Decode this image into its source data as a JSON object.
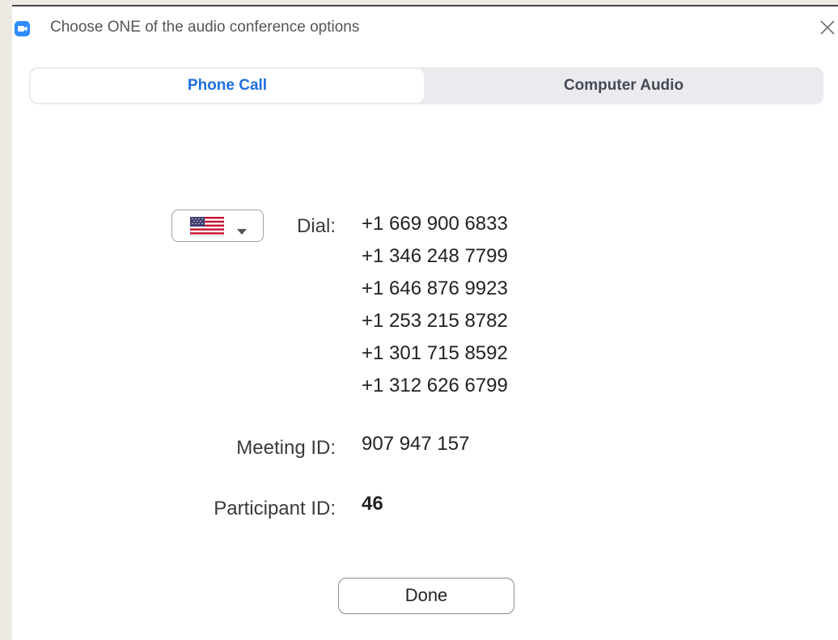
{
  "window": {
    "title": "Choose ONE of the audio conference options",
    "close_icon": "close-icon",
    "app_icon": "zoom-camera-icon",
    "accent_color": "#2d8cff"
  },
  "tabs": [
    {
      "label": "Phone Call",
      "selected": true
    },
    {
      "label": "Computer Audio",
      "selected": false
    }
  ],
  "phone": {
    "country": {
      "icon": "us-flag-icon",
      "dropdown_icon": "caret-down-icon"
    },
    "dial_label": "Dial:",
    "numbers": [
      "+1 669 900 6833",
      "+1 346 248 7799",
      "+1 646 876 9923",
      "+1 253 215 8782",
      "+1 301 715 8592",
      "+1 312 626 6799"
    ],
    "meeting_id_label": "Meeting ID:",
    "meeting_id": "907 947 157",
    "participant_id_label": "Participant ID:",
    "participant_id": "46"
  },
  "done_label": "Done"
}
